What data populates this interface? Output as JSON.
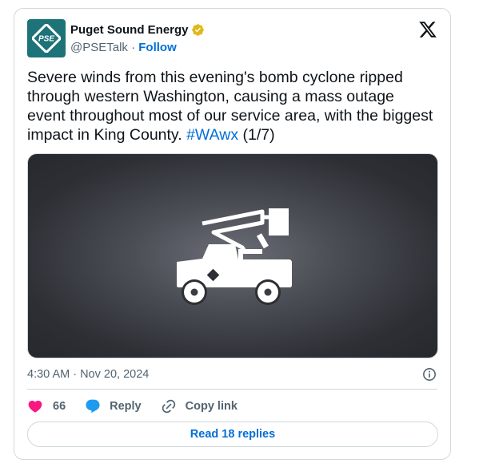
{
  "author": {
    "name": "Puget Sound Energy",
    "handle": "@PSETalk",
    "separator": " · ",
    "follow_label": "Follow",
    "avatar_text": "PSE",
    "avatar_color": "#1d7377",
    "verified": true,
    "verified_badge": "gold-verified-badge-icon"
  },
  "tweet": {
    "text": "Severe winds from this evening's bomb cyclone ripped through western Washington, causing a mass outage event throughout most of our service area, with the biggest impact in King County. ",
    "hashtag": "#WAwx",
    "suffix": " (1/7)"
  },
  "media": {
    "icon": "bucket-truck-icon"
  },
  "meta": {
    "timestamp": "4:30 AM · Nov 20, 2024"
  },
  "actions": {
    "like_count": "66",
    "reply_label": "Reply",
    "copy_link_label": "Copy link"
  },
  "read_replies_label": "Read 18 replies",
  "colors": {
    "link": "#006fd6",
    "like": "#f91880",
    "reply": "#1d9bf0",
    "secondary_text": "#536471",
    "border": "#cfd9de"
  }
}
